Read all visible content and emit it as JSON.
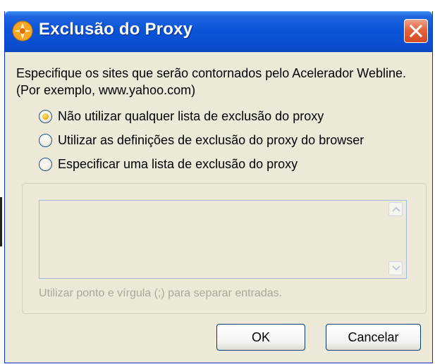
{
  "window": {
    "title": "Exclusão do Proxy",
    "close_label": "×"
  },
  "instructions": {
    "text": "Especifique os sites que serão contornados pelo Acelerador Webline. (Por exemplo, www.yahoo.com)"
  },
  "options": [
    {
      "label": "Não utilizar qualquer lista de exclusão do proxy",
      "selected": true
    },
    {
      "label": "Utilizar as definições de exclusão do proxy do browser",
      "selected": false
    },
    {
      "label": "Especificar uma lista de exclusão do proxy",
      "selected": false
    }
  ],
  "exclusion_list": {
    "value": "",
    "hint": "Utilizar ponto e vírgula (;) para separar entradas."
  },
  "buttons": {
    "ok": "OK",
    "cancel": "Cancelar"
  },
  "icons": {
    "app": "webline-accelerator-icon",
    "close": "close-icon",
    "scroll_up": "chevron-up-icon",
    "scroll_down": "chevron-down-icon"
  },
  "colors": {
    "titlebar": "#0b55d8",
    "dialog_bg": "#ece9d8",
    "close_button": "#e2643f",
    "disabled_text": "#aca899"
  }
}
